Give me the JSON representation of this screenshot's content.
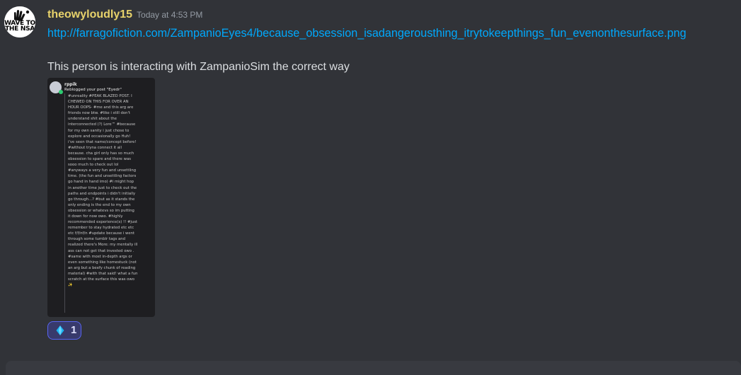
{
  "message": {
    "avatar": {
      "icon": "wave-hand-icon",
      "text_line1": "WAVE TO",
      "text_line2": "THE NSA"
    },
    "username": "theowyloudly15",
    "timestamp": "Today at 4:53 PM",
    "link_text": "http://farragofiction.com/ZampanioEyes4/because_obsession_isadangerousthing_itrytokeepthings_fun_evenonthesurface.png",
    "text": "This person is interacting with ZampanioSim the correct way",
    "attachment": {
      "username": "rppik",
      "reblog_text": "Reblogged your post \"Eyedr\"",
      "body": "#unreality #PEAK BLAZED POST. I\nCHEWED ON THIS FOR OVER AN\nHOUR OOPS- #me and this arg are\nfriends now btw. #like i still don't\nunderstand shit about the\ninterconnected (?) Lore™ #because\nfor my own sanity i just chose to\nexplore and occasionally go Huh!\ni've seen that name/concept before!\n#without tryna connect it all\nbecause. cha girl only has so much\nobsession to spare and there was\nsooo much to check out lol\n#anyways a very fun and unsettling\ntime. (the fun and unsettling factors\ngo hand in hand imo) #i might hop\nin another time just to check out the\npaths and endpoints i didn't initially\ngo through...? #but as it stands the\nonly ending is the end to my own\nobsession or whatevs so im putting\nit down for now owo. #highly\nrecommended experience(s) !! #just\nremember to stay hydrated etc etc\netc f/f/nf/n #update because i went\nthrough some tumblr tags and\nrealized there's More: my mentally ill\nass can not get that invested owo .\n#same with most in-depth args or\neven something like homestuck (not\nan arg but a beefy chunk of reading\nmaterial) #with that said! what a fun\nscratch at the surface this was owo\n✨"
    },
    "reaction": {
      "emoji": "diamond-icon",
      "count": "1"
    }
  },
  "colors": {
    "background": "#313338",
    "username": "#e7d26b",
    "link": "#00a8fc",
    "reaction_border": "#5865f2",
    "reaction_bg": "#383a6c"
  }
}
